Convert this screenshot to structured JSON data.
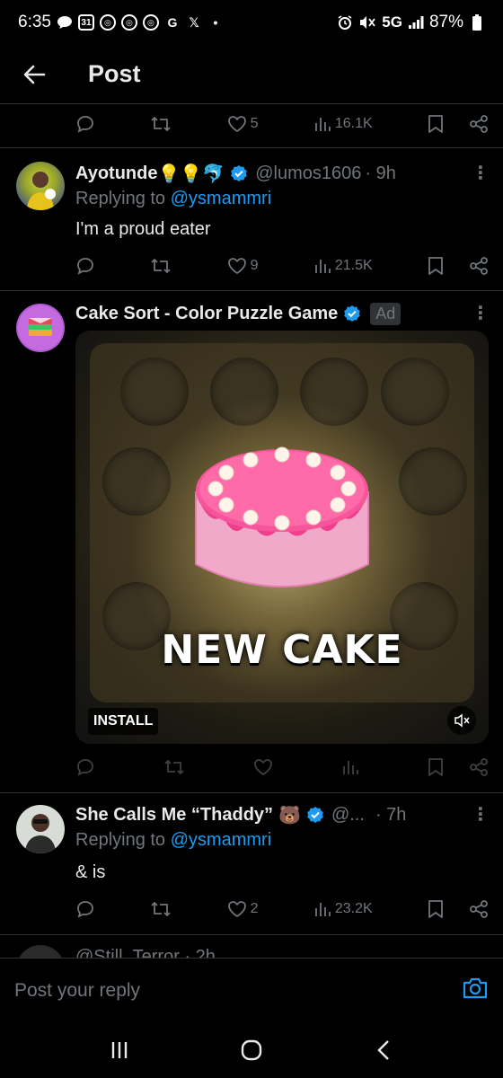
{
  "status_bar": {
    "time": "6:35",
    "network": "5G",
    "battery": "87%"
  },
  "header": {
    "title": "Post"
  },
  "top_actions": {
    "likes": "5",
    "views": "16.1K"
  },
  "tweets": [
    {
      "name": "Ayotunde",
      "emoji": "💡💡🐬",
      "handle": "@lumos1606",
      "time": "· 9h",
      "replying_label": "Replying to",
      "replying_to": "@ysmammri",
      "text": "I'm a proud eater",
      "likes": "9",
      "views": "21.5K"
    },
    {
      "name": "Cake Sort - Color Puzzle Game",
      "ad_label": "Ad",
      "media_text": "NEW CAKE",
      "install_label": "INSTALL"
    },
    {
      "name": "She Calls Me “Thaddy”",
      "emoji": "🐻",
      "handle": "@...",
      "time": "· 7h",
      "replying_label": "Replying to",
      "replying_to": "@ysmammri",
      "text": "& is",
      "likes": "2",
      "views": "23.2K"
    },
    {
      "peek_text": "@Still_Terror · 2h"
    }
  ],
  "reply_bar": {
    "placeholder": "Post your reply"
  },
  "colors": {
    "background": "#000000",
    "text_primary": "#e7e9ea",
    "text_secondary": "#71767b",
    "accent": "#1d9bf0",
    "divider": "#2f3336"
  }
}
